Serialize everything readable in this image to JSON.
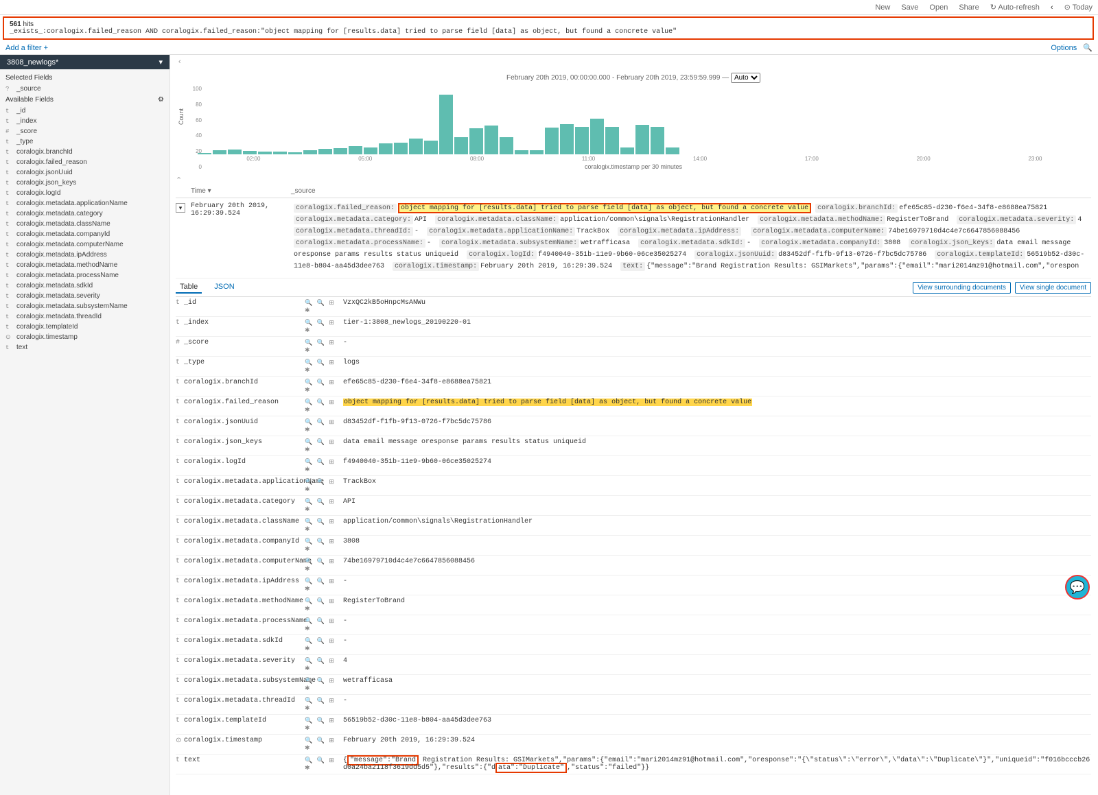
{
  "topnav": {
    "new": "New",
    "save": "Save",
    "open": "Open",
    "share": "Share",
    "autorefresh": "Auto-refresh",
    "today": "Today",
    "options": "Options"
  },
  "query": {
    "hits_count": "561",
    "hits_label": "hits",
    "text": "_exists_:coralogix.failed_reason AND coralogix.failed_reason:\"object mapping for [results.data] tried to parse field [data] as object, but found a concrete value\""
  },
  "filters": {
    "add": "Add a filter +"
  },
  "sidebar": {
    "index": "3808_newlogs*",
    "selected_head": "Selected Fields",
    "selected": [
      {
        "t": "?",
        "n": "_source"
      }
    ],
    "available_head": "Available Fields",
    "available": [
      {
        "t": "t",
        "n": "_id"
      },
      {
        "t": "t",
        "n": "_index"
      },
      {
        "t": "#",
        "n": "_score"
      },
      {
        "t": "t",
        "n": "_type"
      },
      {
        "t": "t",
        "n": "coralogix.branchId"
      },
      {
        "t": "t",
        "n": "coralogix.failed_reason"
      },
      {
        "t": "t",
        "n": "coralogix.jsonUuid"
      },
      {
        "t": "t",
        "n": "coralogix.json_keys"
      },
      {
        "t": "t",
        "n": "coralogix.logId"
      },
      {
        "t": "t",
        "n": "coralogix.metadata.applicationName"
      },
      {
        "t": "t",
        "n": "coralogix.metadata.category"
      },
      {
        "t": "t",
        "n": "coralogix.metadata.className"
      },
      {
        "t": "t",
        "n": "coralogix.metadata.companyId"
      },
      {
        "t": "t",
        "n": "coralogix.metadata.computerName"
      },
      {
        "t": "t",
        "n": "coralogix.metadata.ipAddress"
      },
      {
        "t": "t",
        "n": "coralogix.metadata.methodName"
      },
      {
        "t": "t",
        "n": "coralogix.metadata.processName"
      },
      {
        "t": "t",
        "n": "coralogix.metadata.sdkId"
      },
      {
        "t": "t",
        "n": "coralogix.metadata.severity"
      },
      {
        "t": "t",
        "n": "coralogix.metadata.subsystemName"
      },
      {
        "t": "t",
        "n": "coralogix.metadata.threadId"
      },
      {
        "t": "t",
        "n": "coralogix.templateId"
      },
      {
        "t": "⊙",
        "n": "coralogix.timestamp"
      },
      {
        "t": "t",
        "n": "text"
      }
    ]
  },
  "chart": {
    "range": "February 20th 2019, 00:00:00.000 - February 20th 2019, 23:59:59.999 —",
    "scale": "Auto",
    "ylabel": "Count",
    "xlabel": "coralogix.timestamp per 30 minutes"
  },
  "chart_data": {
    "type": "bar",
    "title": "",
    "xlabel": "coralogix.timestamp per 30 minutes",
    "ylabel": "Count",
    "ylim": [
      0,
      100
    ],
    "yticks": [
      0,
      20,
      40,
      60,
      80,
      100
    ],
    "xticks": [
      "02:00",
      "05:00",
      "08:00",
      "11:00",
      "14:00",
      "17:00",
      "20:00",
      "23:00"
    ],
    "categories": [
      "01:00",
      "01:30",
      "02:00",
      "02:30",
      "03:00",
      "03:30",
      "04:00",
      "04:30",
      "05:00",
      "05:30",
      "06:00",
      "06:30",
      "07:00",
      "07:30",
      "08:00",
      "08:30",
      "09:00",
      "09:30",
      "10:00",
      "10:30",
      "11:00",
      "11:30",
      "12:00",
      "12:30",
      "13:00",
      "13:30",
      "14:00",
      "14:30",
      "15:00",
      "15:30",
      "16:00",
      "16:30"
    ],
    "values": [
      2,
      6,
      7,
      5,
      4,
      4,
      3,
      6,
      8,
      9,
      12,
      10,
      16,
      17,
      23,
      20,
      87,
      25,
      38,
      42,
      25,
      6,
      6,
      39,
      44,
      40,
      52,
      40,
      10,
      43,
      40,
      10
    ]
  },
  "columns": {
    "time": "Time ▾",
    "source": "_source"
  },
  "doc": {
    "time": "February 20th 2019, 16:29:39.524",
    "src": {
      "failed_reason_key": "coralogix.failed_reason:",
      "failed_reason_val": "object mapping for [results.data] tried to parse field [data] as object, but found a concrete value",
      "branchId_key": "coralogix.branchId:",
      "branchId_val": "efe65c85-d230-f6e4-34f8-e8688ea75821",
      "cat_key": "coralogix.metadata.category:",
      "cat_val": "API",
      "class_key": "coralogix.metadata.className:",
      "class_val": "application/common\\signals\\RegistrationHandler",
      "method_key": "coralogix.metadata.methodName:",
      "method_val": "RegisterToBrand",
      "sev_key": "coralogix.metadata.severity:",
      "sev_val": "4",
      "thread_key": "coralogix.metadata.threadId:",
      "thread_val": "-",
      "app_key": "coralogix.metadata.applicationName:",
      "app_val": "TrackBox",
      "ip_key": "coralogix.metadata.ipAddress:",
      "ip_val": "",
      "comp_key": "coralogix.metadata.computerName:",
      "comp_val": "74be16979710d4c4e7c6647856088456",
      "proc_key": "coralogix.metadata.processName:",
      "proc_val": "-",
      "subsys_key": "coralogix.metadata.subsystemName:",
      "subsys_val": "wetrafficasa",
      "sdk_key": "coralogix.metadata.sdkId:",
      "sdk_val": "-",
      "company_key": "coralogix.metadata.companyId:",
      "company_val": "3808",
      "json_keys_key": "coralogix.json_keys:",
      "json_keys_val": "data email message oresponse params results status uniqueid",
      "logid_key": "coralogix.logId:",
      "logid_val": "f4940040-351b-11e9-9b60-06ce35025274",
      "jsonuuid_key": "coralogix.jsonUuid:",
      "jsonuuid_val": "d83452df-f1fb-9f13-0726-f7bc5dc75786",
      "tmpl_key": "coralogix.templateId:",
      "tmpl_val": "56519b52-d30c-11e8-b804-aa45d3dee763",
      "ts_key": "coralogix.timestamp:",
      "ts_val": "February 20th 2019, 16:29:39.524",
      "text_key": "text:",
      "text_val": "{\"message\":\"Brand Registration Results: GSIMarkets\",\"params\":{\"email\":\"mari2014mz91@hotmail.com\",\"orespon"
    }
  },
  "tabs": {
    "table": "Table",
    "json": "JSON",
    "surrounding": "View surrounding documents",
    "single": "View single document"
  },
  "details": [
    {
      "t": "t",
      "n": "_id",
      "v": "VzxQC2kB5oHnpcMsANWu",
      "g": true
    },
    {
      "t": "t",
      "n": "_index",
      "v": "tier-1:3808_newlogs_20190220-01",
      "g": true
    },
    {
      "t": "#",
      "n": "_score",
      "v": "-",
      "g": true
    },
    {
      "t": "t",
      "n": "_type",
      "v": "logs",
      "g": true
    },
    {
      "t": "t",
      "n": "coralogix.branchId",
      "v": "efe65c85-d230-f6e4-34f8-e8688ea75821"
    },
    {
      "t": "t",
      "n": "coralogix.failed_reason",
      "v": "object mapping for [results.data] tried to parse field [data] as object, but found a concrete value",
      "hl": true
    },
    {
      "t": "t",
      "n": "coralogix.jsonUuid",
      "v": "d83452df-f1fb-9f13-0726-f7bc5dc75786"
    },
    {
      "t": "t",
      "n": "coralogix.json_keys",
      "v": "data email message oresponse params results status uniqueid"
    },
    {
      "t": "t",
      "n": "coralogix.logId",
      "v": "f4940040-351b-11e9-9b60-06ce35025274"
    },
    {
      "t": "t",
      "n": "coralogix.metadata.applicationName",
      "v": "TrackBox"
    },
    {
      "t": "t",
      "n": "coralogix.metadata.category",
      "v": "API"
    },
    {
      "t": "t",
      "n": "coralogix.metadata.className",
      "v": "application/common\\signals\\RegistrationHandler"
    },
    {
      "t": "t",
      "n": "coralogix.metadata.companyId",
      "v": "3808"
    },
    {
      "t": "t",
      "n": "coralogix.metadata.computerName",
      "v": "74be16979710d4c4e7c6647856088456"
    },
    {
      "t": "t",
      "n": "coralogix.metadata.ipAddress",
      "v": "-"
    },
    {
      "t": "t",
      "n": "coralogix.metadata.methodName",
      "v": "RegisterToBrand"
    },
    {
      "t": "t",
      "n": "coralogix.metadata.processName",
      "v": "-"
    },
    {
      "t": "t",
      "n": "coralogix.metadata.sdkId",
      "v": "-"
    },
    {
      "t": "t",
      "n": "coralogix.metadata.severity",
      "v": "4"
    },
    {
      "t": "t",
      "n": "coralogix.metadata.subsystemName",
      "v": "wetrafficasa"
    },
    {
      "t": "t",
      "n": "coralogix.metadata.threadId",
      "v": "-"
    },
    {
      "t": "t",
      "n": "coralogix.templateId",
      "v": "56519b52-d30c-11e8-b804-aa45d3dee763"
    },
    {
      "t": "⊙",
      "n": "coralogix.timestamp",
      "v": "February 20th 2019, 16:29:39.524"
    },
    {
      "t": "t",
      "n": "text",
      "v": "{\"message\":\"Brand Registration Results: GSIMarkets\",\"params\":{\"email\":\"mari2014mz91@hotmail.com\",\"oresponse\":\"{\\\"status\\\":\\\"error\\\",\\\"data\\\":\\\"Duplicate\\\"}\",\"uniqueid\":\"f016bcccb26d0a24ba2118f3619dd5d5\"},\"results\":{\"data\":\"Duplicate\",\"status\":\"failed\"}}",
      "boxes": [
        [
          "\"message\":\"Brand"
        ],
        [
          "\",\"results\":"
        ],
        [
          "ata\":\"Duplicate\""
        ]
      ]
    }
  ]
}
